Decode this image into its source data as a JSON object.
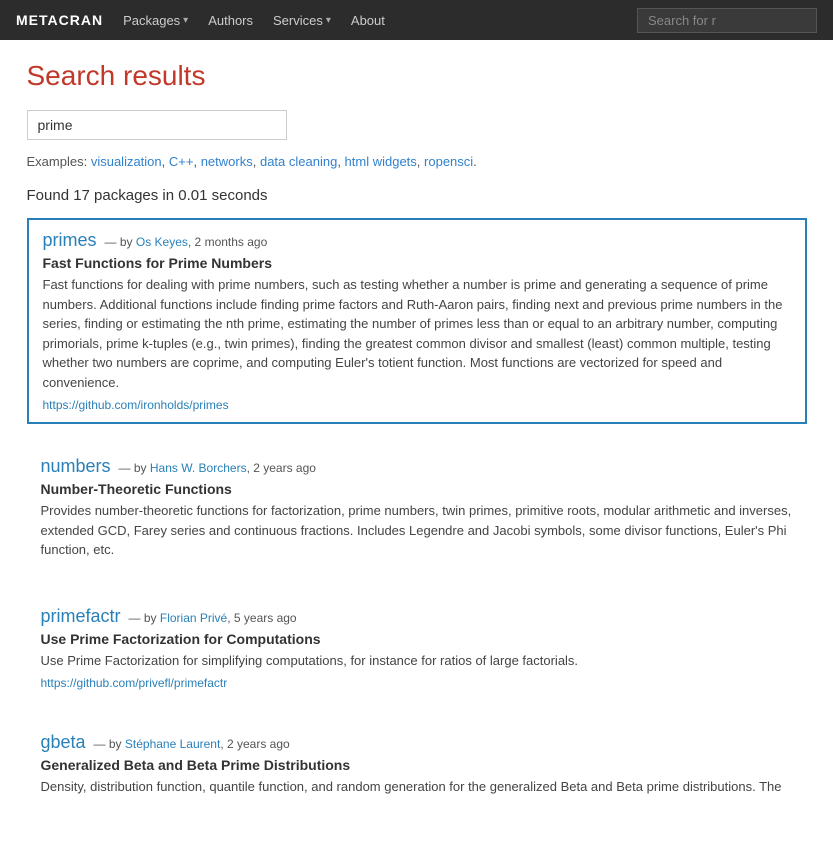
{
  "navbar": {
    "brand": "METACRAN",
    "items": [
      {
        "label": "Packages",
        "has_dropdown": true
      },
      {
        "label": "Authors",
        "has_dropdown": false
      },
      {
        "label": "Services",
        "has_dropdown": true
      },
      {
        "label": "About",
        "has_dropdown": false
      }
    ],
    "search_placeholder": "Search for r"
  },
  "page": {
    "title": "Search results",
    "search_value": "prime",
    "examples_prefix": "Examples:",
    "examples": [
      {
        "label": "visualization",
        "href": "#"
      },
      {
        "label": "C++",
        "href": "#"
      },
      {
        "label": "networks",
        "href": "#"
      },
      {
        "label": "data cleaning",
        "href": "#"
      },
      {
        "label": "html widgets",
        "href": "#"
      },
      {
        "label": "ropensci",
        "href": "#"
      }
    ],
    "found_label": "Found 17 packages in 0.01 seconds"
  },
  "packages": [
    {
      "name": "primes",
      "meta": "— by Os Keyes, 2 months ago",
      "author": "Os Keyes",
      "age": "2 months ago",
      "subtitle": "Fast Functions for Prime Numbers",
      "description": "Fast functions for dealing with prime numbers, such as testing whether a number is prime and generating a sequence of prime numbers. Additional functions include finding prime factors and Ruth-Aaron pairs, finding next and previous prime numbers in the series, finding or estimating the nth prime, estimating the number of primes less than or equal to an arbitrary number, computing primorials, prime k-tuples (e.g., twin primes), finding the greatest common divisor and smallest (least) common multiple, testing whether two numbers are coprime, and computing Euler's totient function. Most functions are vectorized for speed and convenience.",
      "link": "https://github.com/ironholds/primes",
      "highlighted": true
    },
    {
      "name": "numbers",
      "meta": "— by Hans W. Borchers, 2 years ago",
      "author": "Hans W. Borchers",
      "age": "2 years ago",
      "subtitle": "Number-Theoretic Functions",
      "description": "Provides number-theoretic functions for factorization, prime numbers, twin primes, primitive roots, modular arithmetic and inverses, extended GCD, Farey series and continuous fractions. Includes Legendre and Jacobi symbols, some divisor functions, Euler's Phi function, etc.",
      "link": null,
      "highlighted": false
    },
    {
      "name": "primefactr",
      "meta": "— by Florian Privé, 5 years ago",
      "author": "Florian Privé",
      "age": "5 years ago",
      "subtitle": "Use Prime Factorization for Computations",
      "description": "Use Prime Factorization for simplifying computations, for instance for ratios of large factorials.",
      "link": "https://github.com/privefl/primefactr",
      "highlighted": false
    },
    {
      "name": "gbeta",
      "meta": "— by Stéphane Laurent, 2 years ago",
      "author": "Stéphane Laurent",
      "age": "2 years ago",
      "subtitle": "Generalized Beta and Beta Prime Distributions",
      "description": "Density, distribution function, quantile function, and random generation for the generalized Beta and Beta prime distributions. The",
      "link": null,
      "highlighted": false
    }
  ]
}
